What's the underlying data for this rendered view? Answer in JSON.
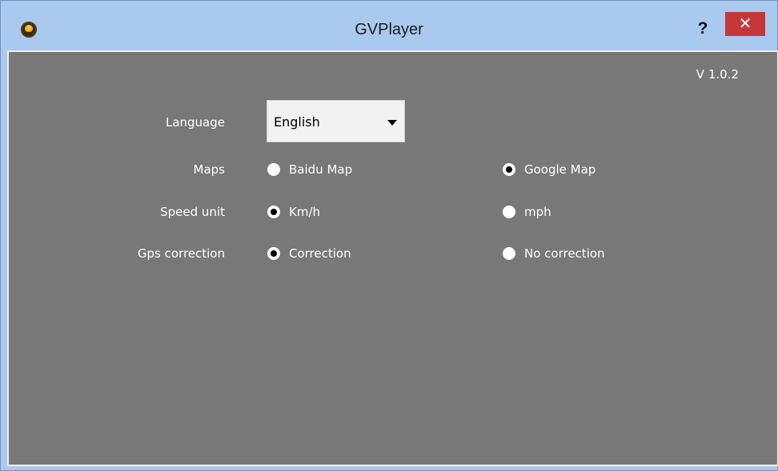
{
  "window": {
    "title": "GVPlayer",
    "help_label": "?",
    "close_label": "✕",
    "app_icon": "eye-icon"
  },
  "settings": {
    "version": "V 1.0.2",
    "language": {
      "label": "Language",
      "value": "English"
    },
    "maps": {
      "label": "Maps",
      "options": [
        {
          "label": "Baidu Map",
          "checked": false
        },
        {
          "label": "Google Map",
          "checked": true
        }
      ]
    },
    "speed_unit": {
      "label": "Speed unit",
      "options": [
        {
          "label": "Km/h",
          "checked": true
        },
        {
          "label": "mph",
          "checked": false
        }
      ]
    },
    "gps_correction": {
      "label": "Gps correction",
      "options": [
        {
          "label": "Correction",
          "checked": true
        },
        {
          "label": "No correction",
          "checked": false
        }
      ]
    }
  },
  "colors": {
    "titlebar": "#a9c9ee",
    "client_bg": "#787878",
    "close_button": "#c43838"
  }
}
